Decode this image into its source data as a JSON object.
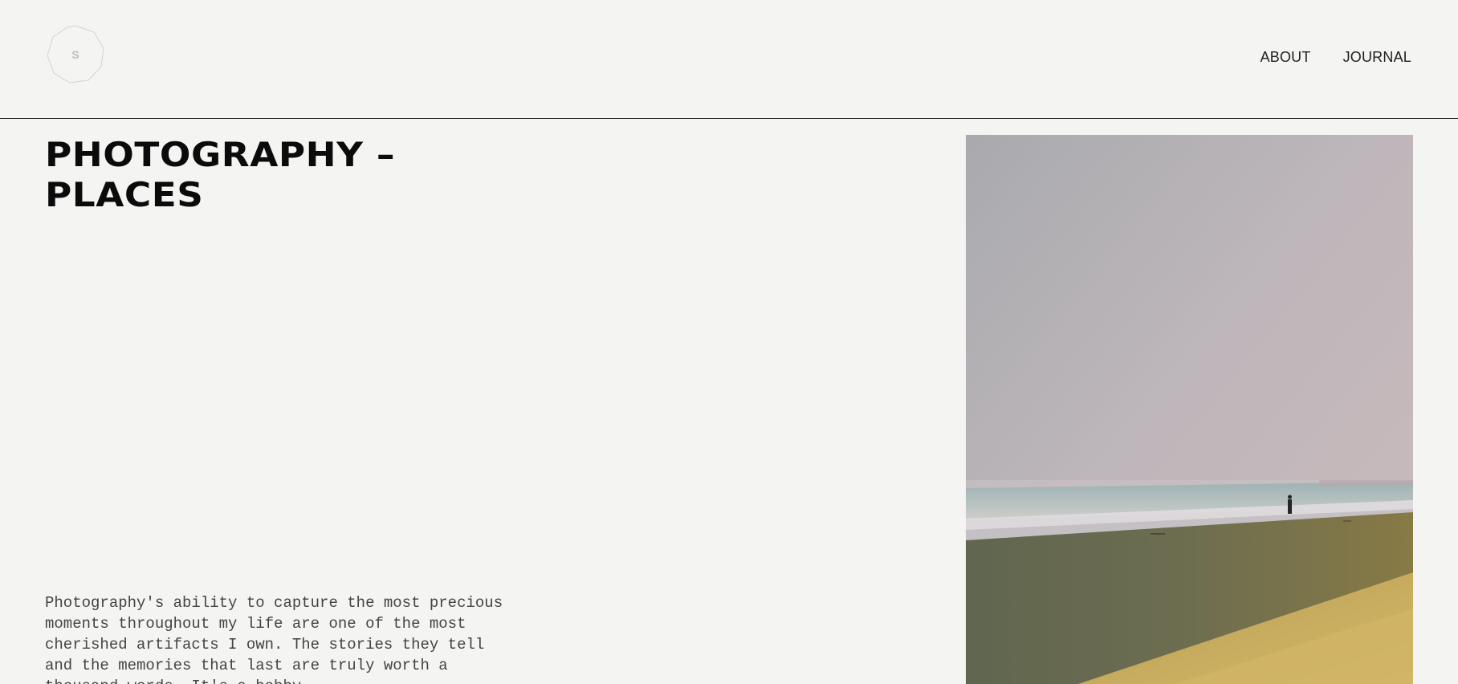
{
  "logo": {
    "letter": "S",
    "icon": "octagon-logo-icon"
  },
  "nav": {
    "items": [
      {
        "label": "ABOUT"
      },
      {
        "label": "JOURNAL"
      }
    ]
  },
  "main": {
    "title": "PHOTOGRAPHY –\nPLACES",
    "intro": "Photography's ability to capture the most precious moments throughout my life are one of the most cherished artifacts I own. The stories they tell and the memories that last are truly worth a thousand words. It's a hobby"
  },
  "photo": {
    "subject": "beach-photo"
  },
  "colors": {
    "background": "#f4f4f2",
    "divider": "#1a1a1a",
    "logo_outline": "#d6d6d4",
    "text": "#111111"
  }
}
